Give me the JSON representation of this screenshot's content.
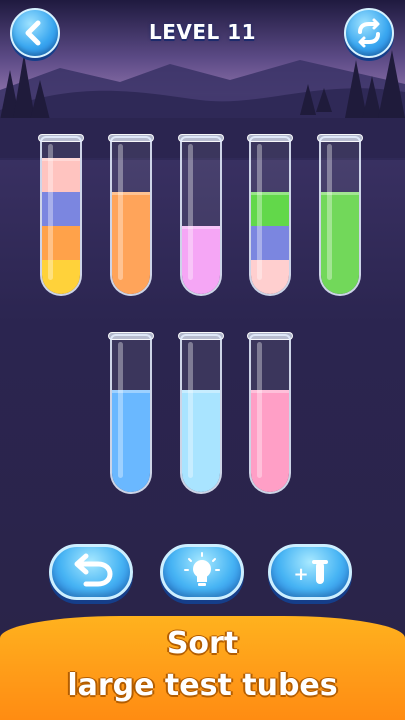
{
  "header": {
    "title": "LEVEL 11",
    "back_icon": "chevron-left-icon",
    "restart_icon": "restart-arrows-icon"
  },
  "tubes": [
    {
      "layers": [
        "#ffd23a",
        "#ffa24a",
        "#7b86e0",
        "#ffc4c0"
      ],
      "capacity": 4
    },
    {
      "layers": [
        "#ffa45a",
        "#ffa45a",
        "#ffa45a"
      ],
      "capacity": 4
    },
    {
      "layers": [
        "#f5a6f5",
        "#f5a6f5"
      ],
      "capacity": 4
    },
    {
      "layers": [
        "#ffcfcf",
        "#7b86e0",
        "#62d84a"
      ],
      "capacity": 4
    },
    {
      "layers": [
        "#72d85a",
        "#72d85a",
        "#72d85a"
      ],
      "capacity": 4
    },
    {
      "layers": [
        "#6ab8ff",
        "#6ab8ff",
        "#6ab8ff"
      ],
      "capacity": 4
    },
    {
      "layers": [
        "#a9e4ff",
        "#a9e4ff",
        "#a9e4ff"
      ],
      "capacity": 4
    },
    {
      "layers": [
        "#ff9fc6",
        "#ff9fc6",
        "#ff9fc6"
      ],
      "capacity": 4
    }
  ],
  "controls": {
    "undo_icon": "undo-arrow-icon",
    "hint_icon": "lightbulb-icon",
    "add_tube_icon": "add-tube-icon",
    "add_tube_text": "+"
  },
  "banner": {
    "line1": "Sort",
    "line2": "large test tubes"
  },
  "colors": {
    "sky_top": "#241f45",
    "accent_blue": "#3aa7f0",
    "banner_orange": "#ffa21c"
  }
}
